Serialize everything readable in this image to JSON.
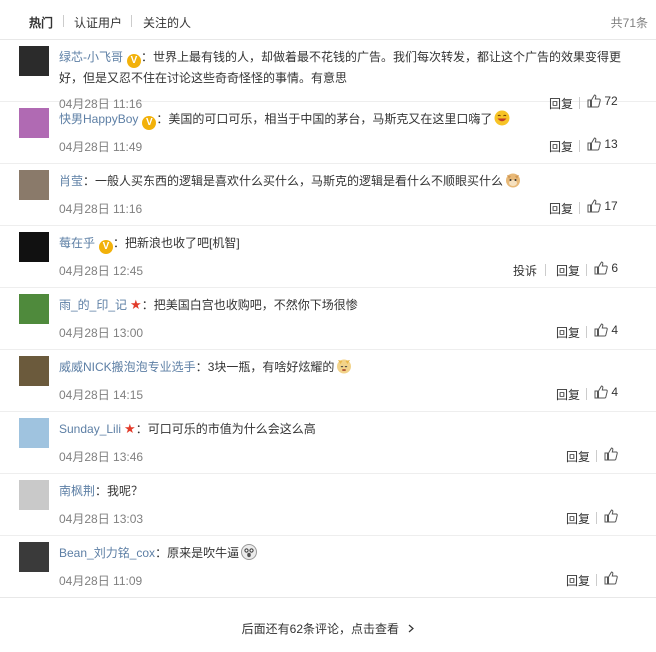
{
  "tabs": {
    "hot": "热门",
    "verified": "认证用户",
    "following": "关注的人",
    "total": "共71条"
  },
  "actions": {
    "reply": "回复",
    "report": "投诉"
  },
  "comments": [
    {
      "user": "绿芯-小飞哥",
      "badge": "v",
      "sep": "：",
      "text": "世界上最有钱的人，却做着最不花钱的广告。我们每次转发，都让这个广告的效果变得更好，但是又忍不住在讨论这些奇奇怪怪的事情。有意思",
      "time": "04月28日 11:16",
      "likes": "72",
      "avatar_color": "#2b2b2b"
    },
    {
      "user": "快男HappyBoy",
      "badge": "v",
      "sep": "：",
      "text": "美国的可口可乐，相当于中国的茅台，马斯克又在这里口嗨了",
      "time": "04月28日 11:49",
      "likes": "13",
      "avatar_color": "#b06ab3",
      "emoji": "laugh-emoji"
    },
    {
      "user": "肖莹",
      "badge": "",
      "sep": "：",
      "text": "一般人买东西的逻辑是喜欢什么买什么，马斯克的逻辑是看什么不顺眼买什么",
      "time": "04月28日 11:16",
      "likes": "17",
      "avatar_color": "#8a7a6a",
      "emoji": "doge-emoji"
    },
    {
      "user": "莓在乎",
      "badge": "v",
      "sep": "：",
      "text": "把新浪也收了吧[机智]",
      "time": "04月28日 12:45",
      "likes": "6",
      "avatar_color": "#111111",
      "report": true
    },
    {
      "user": "雨_的_印_记",
      "badge": "star",
      "sep": "：",
      "text": "把美国白宫也收购吧，不然你下场很惨",
      "time": "04月28日 13:00",
      "likes": "4",
      "avatar_color": "#4f8a3c"
    },
    {
      "user": "威威NICK搬泡泡专业选手",
      "badge": "",
      "sep": "：",
      "text": "3块一瓶，有啥好炫耀的",
      "time": "04月28日 14:15",
      "likes": "4",
      "avatar_color": "#6b5a3c",
      "emoji": "shiba-emoji"
    },
    {
      "user": "Sunday_Lili",
      "badge": "star",
      "sep": "：",
      "text": "可口可乐的市值为什么会这么高",
      "time": "04月28日 13:46",
      "likes": "",
      "avatar_color": "#9fc3df"
    },
    {
      "user": "南枫荆",
      "badge": "",
      "sep": "：",
      "text": "我呢？",
      "time": "04月28日 13:03",
      "likes": "",
      "avatar_color": "#c9c9c9"
    },
    {
      "user": "Bean_刘力铭_cox",
      "badge": "",
      "sep": "：",
      "text": "原来是吹牛逼",
      "time": "04月28日 11:09",
      "likes": "",
      "avatar_color": "#3a3a3a",
      "emoji": "shocked-emoji"
    }
  ],
  "more": "后面还有62条评论，点击查看",
  "colors": {
    "username": "#5d7fa5",
    "badge_v": "#f2b10a",
    "badge_star": "#e23b2a",
    "time": "#808080"
  }
}
